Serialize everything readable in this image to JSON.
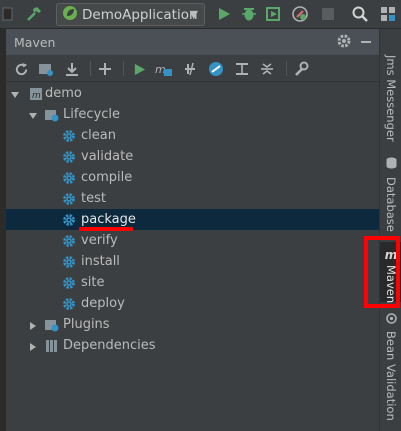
{
  "toolbar": {
    "run_config": "DemoApplication"
  },
  "panel": {
    "title": "Maven"
  },
  "tree": {
    "root": "demo",
    "lifecycle": "Lifecycle",
    "goals": [
      "clean",
      "validate",
      "compile",
      "test",
      "package",
      "verify",
      "install",
      "site",
      "deploy"
    ],
    "selected": "package",
    "plugins": "Plugins",
    "dependencies": "Dependencies"
  },
  "right_tabs": {
    "jms": "Jms Messenger",
    "database": "Database",
    "maven": "Maven",
    "bean": "Bean Validation"
  },
  "colors": {
    "panel_bg": "#3c3f41",
    "header_bg": "#4a5055",
    "selection_bg": "#0d293e",
    "highlight": "#ff0000",
    "run_green": "#59a869",
    "gear_blue": "#3592c4"
  }
}
